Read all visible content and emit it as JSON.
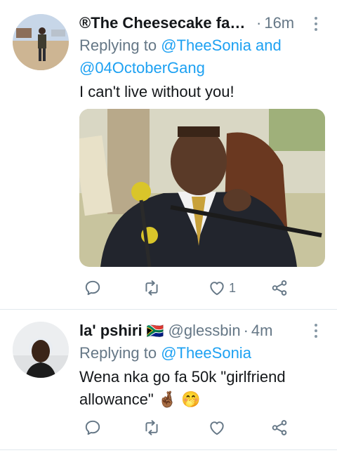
{
  "tweets": [
    {
      "name": "®The Cheesecake fact...",
      "handle": "",
      "time": "16m",
      "replying_prefix": "Replying to ",
      "replying_to": "@TheeSonia and",
      "replying_to_2": "@04OctoberGang",
      "text": "I can't live without you!",
      "reply_count": "",
      "retweet_count": "",
      "like_count": "1"
    },
    {
      "name": "la' pshiri",
      "flag": "🇿🇦",
      "handle": "@glessbin",
      "time": "4m",
      "replying_prefix": "Replying to ",
      "replying_to": "@TheeSonia",
      "text_line1": "Wena nka go fa 50k \"girlfriend",
      "text_line2": "allowance\"",
      "emojis": "🤞🏾 🤭",
      "like_count": ""
    }
  ],
  "icons": {
    "reply": "reply-icon",
    "retweet": "retweet-icon",
    "like": "heart-icon",
    "share": "share-icon",
    "more": "more-vertical-icon"
  },
  "colors": {
    "link": "#1da1f2",
    "muted": "#657786",
    "divider": "#e1e8ed"
  }
}
